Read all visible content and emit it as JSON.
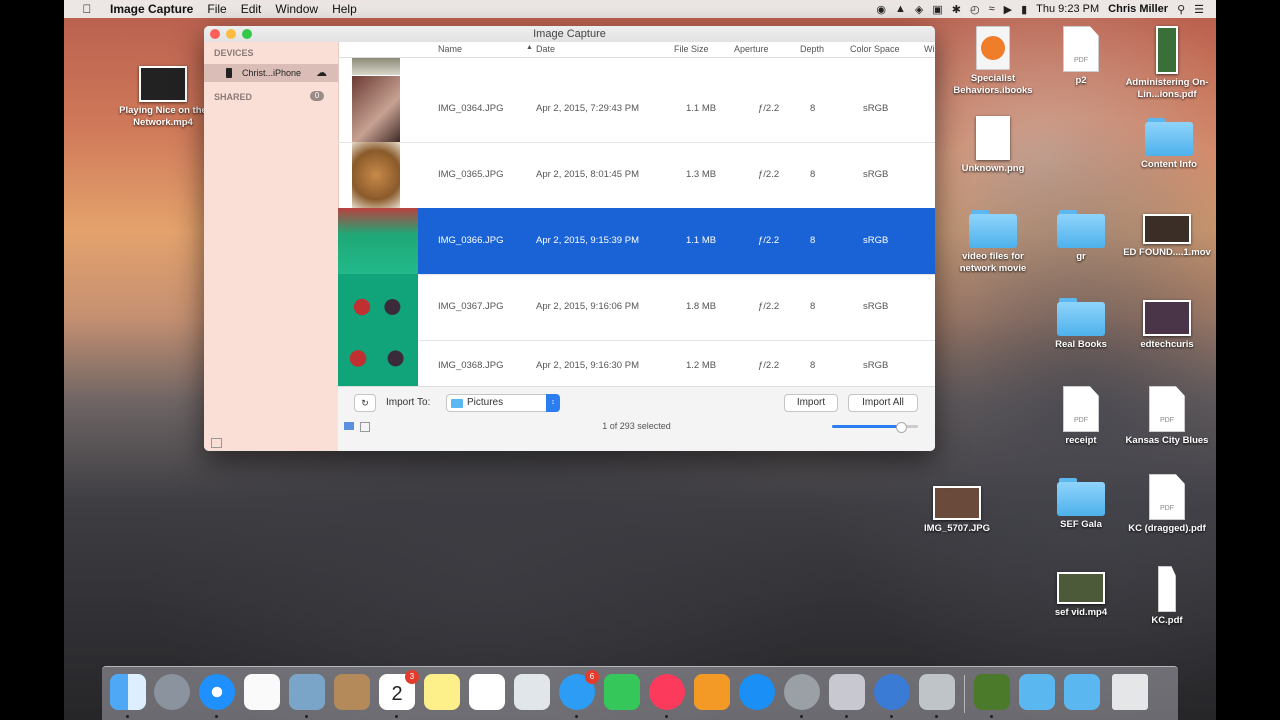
{
  "menubar": {
    "app_name": "Image Capture",
    "menus": [
      "File",
      "Edit",
      "Window",
      "Help"
    ],
    "clock": "Thu 9:23 PM",
    "user": "Chris Miller"
  },
  "window": {
    "title": "Image Capture",
    "sidebar": {
      "devices_header": "DEVICES",
      "device_name": "Christ...iPhone",
      "shared_header": "SHARED",
      "shared_count": "0"
    },
    "columns": [
      "Name",
      "Date",
      "File Size",
      "Aperture",
      "Depth",
      "Color Space",
      "Wi"
    ],
    "rows": [
      {
        "name": "IMG_0364.JPG",
        "date": "Apr 2, 2015, 7:29:43 PM",
        "size": "1.1 MB",
        "aperture": "ƒ/2.2",
        "depth": "8",
        "color": "sRGB"
      },
      {
        "name": "IMG_0365.JPG",
        "date": "Apr 2, 2015, 8:01:45 PM",
        "size": "1.3 MB",
        "aperture": "ƒ/2.2",
        "depth": "8",
        "color": "sRGB"
      },
      {
        "name": "IMG_0366.JPG",
        "date": "Apr 2, 2015, 9:15:39 PM",
        "size": "1.1 MB",
        "aperture": "ƒ/2.2",
        "depth": "8",
        "color": "sRGB"
      },
      {
        "name": "IMG_0367.JPG",
        "date": "Apr 2, 2015, 9:16:06 PM",
        "size": "1.8 MB",
        "aperture": "ƒ/2.2",
        "depth": "8",
        "color": "sRGB"
      },
      {
        "name": "IMG_0368.JPG",
        "date": "Apr 2, 2015, 9:16:30 PM",
        "size": "1.2 MB",
        "aperture": "ƒ/2.2",
        "depth": "8",
        "color": "sRGB"
      }
    ],
    "bottom": {
      "import_to_label": "Import To:",
      "destination": "Pictures",
      "import_button": "Import",
      "import_all_button": "Import All",
      "status": "1 of 293 selected"
    }
  },
  "desktop": {
    "left_icon": "Playing Nice on the Network.mp4",
    "icons": [
      "Specialist Behaviors.ibooks",
      "p2",
      "Administering On-Lin...ions.pdf",
      "Unknown.png",
      "Content Info",
      "video files for network movie",
      "gr",
      "ED FOUND....1.mov",
      "Real Books",
      "edtechcuris",
      "receipt",
      "Kansas City Blues",
      "IMG_5707.JPG",
      "SEF Gala",
      "KC (dragged).pdf",
      "sef vid.mp4",
      "KC.pdf"
    ]
  },
  "dock": {
    "calendar_day": "2",
    "calendar_badge": "3",
    "messages_badge": "6"
  },
  "colors": {
    "selection": "#1a63d6",
    "folder": "#5bb7ef",
    "sidebar": "#fadfd6"
  }
}
